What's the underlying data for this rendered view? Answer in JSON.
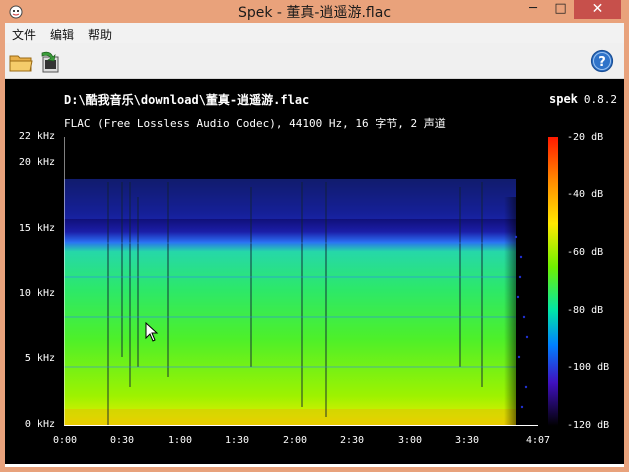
{
  "window": {
    "title": "Spek - 董真-逍遥游.flac",
    "minimize_glyph": "─",
    "maximize_glyph": "□",
    "close_glyph": "✕",
    "accent_color": "#e9a27b",
    "close_color": "#c7504b"
  },
  "menu": {
    "items": [
      "文件",
      "编辑",
      "帮助"
    ]
  },
  "toolbar": {
    "icons": [
      "open-folder-icon",
      "save-image-icon"
    ],
    "help_icon": "help-icon"
  },
  "header": {
    "file_path": "D:\\酷我音乐\\download\\董真-逍遥游.flac",
    "file_info": "FLAC (Free Lossless Audio Codec), 44100 Hz, 16 字节, 2 声道",
    "brand": "spek",
    "version": "0.8.2"
  },
  "chart_data": {
    "type": "heatmap",
    "y_ticks": [
      "22 kHz",
      "20 kHz",
      "15 kHz",
      "10 kHz",
      "5 kHz",
      "0 kHz"
    ],
    "x_ticks": [
      "0:00",
      "0:30",
      "1:00",
      "1:30",
      "2:00",
      "2:30",
      "3:00",
      "3:30",
      "4:07"
    ],
    "colorbar_ticks": [
      "-20 dB",
      "-40 dB",
      "-60 dB",
      "-80 dB",
      "-100 dB",
      "-120 dB"
    ],
    "frequency_range_khz": [
      0,
      22
    ],
    "time_range_s": [
      0,
      247
    ],
    "db_range": [
      -120,
      -20
    ]
  }
}
